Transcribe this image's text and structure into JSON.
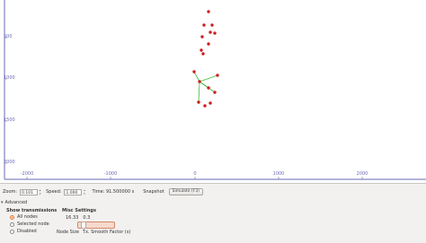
{
  "canvas": {
    "y_ticks": [
      "500",
      "1000",
      "1500",
      "2000"
    ],
    "x_ticks": [
      "-2000",
      "-1000",
      "0",
      "1000",
      "2000"
    ],
    "axis_color": "#6a6ab4",
    "node_color": "#cc1f1f",
    "link_color": "#39c13a"
  },
  "toolbar": {
    "zoom_label": "Zoom:",
    "zoom_value": "0.101",
    "speed_label": "Speed:",
    "speed_value": "1.000",
    "time_label": "Time: 91.500000 s",
    "snapshot_label": "Snapshot",
    "simulate_label": "Simulate (F3)"
  },
  "advanced": {
    "expander_label": "Advanced",
    "show_transmissions_label": "Show transmissions",
    "options": [
      "All nodes",
      "Selected node",
      "Disabled"
    ],
    "misc_settings_label": "Misc Settings",
    "node_size_value": "16.33",
    "tx_smooth_value": "0.3",
    "node_size_label": "Node Size",
    "tx_smooth_label": "Tx. Smooth Factor (s)"
  }
}
